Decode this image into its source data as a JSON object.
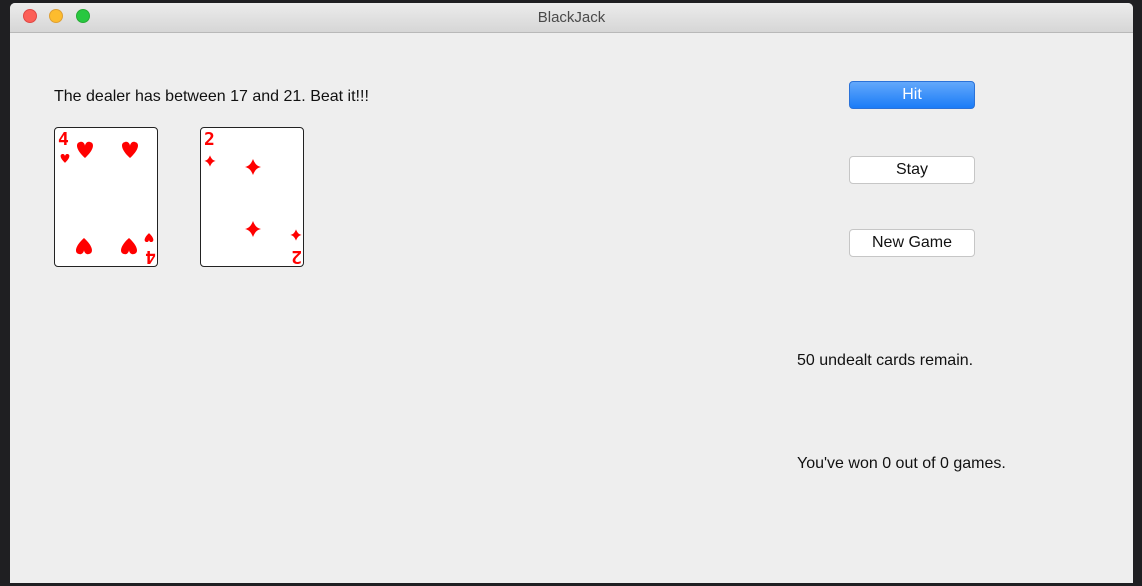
{
  "window": {
    "title": "BlackJack"
  },
  "game": {
    "message": "The dealer has between 17 and 21. Beat it!!!",
    "cards_remaining_text": "50 undealt cards remain.",
    "score_text": "You've won 0 out of 0 games.",
    "player_cards": [
      {
        "rank": "4",
        "suit": "hearts",
        "suit_symbol": "♥",
        "color": "#ff0000"
      },
      {
        "rank": "2",
        "suit": "diamonds",
        "suit_symbol": "♦",
        "color": "#ff0000"
      }
    ]
  },
  "controls": {
    "hit_label": "Hit",
    "stay_label": "Stay",
    "new_game_label": "New Game"
  },
  "colors": {
    "card_suit": "#ff0000",
    "default_button": "#1a7cf7"
  }
}
